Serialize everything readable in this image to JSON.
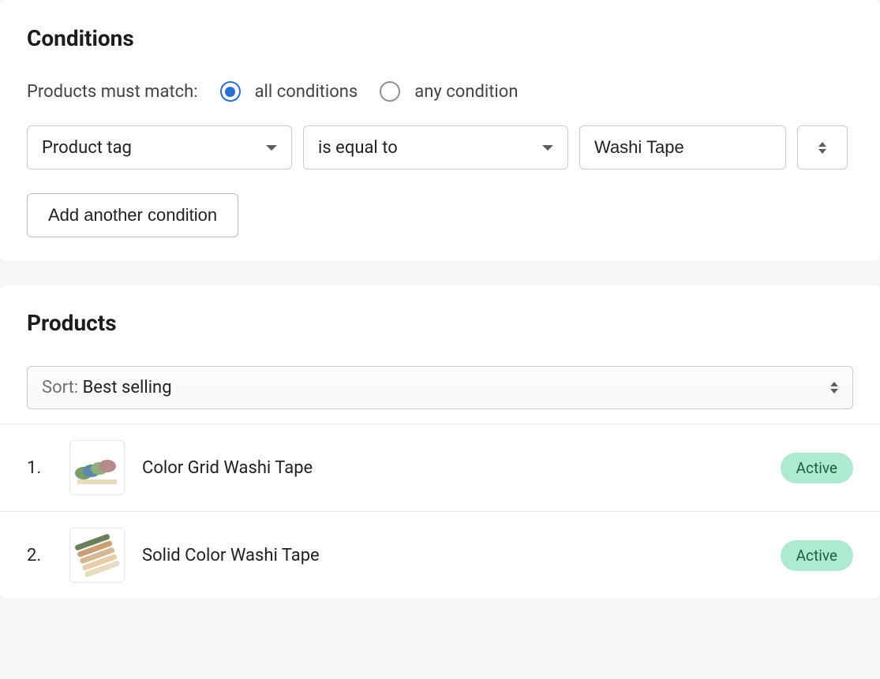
{
  "conditions": {
    "title": "Conditions",
    "match_label": "Products must match:",
    "match_all_label": "all conditions",
    "match_any_label": "any condition",
    "match_selected": "all",
    "rows": [
      {
        "field": "Product tag",
        "operator": "is equal to",
        "value": "Washi Tape"
      }
    ],
    "add_button": "Add another condition"
  },
  "products": {
    "title": "Products",
    "sort_prefix": "Sort: ",
    "sort_value": "Best selling",
    "items": [
      {
        "index": "1.",
        "name": "Color Grid Washi Tape",
        "status": "Active"
      },
      {
        "index": "2.",
        "name": "Solid Color Washi Tape",
        "status": "Active"
      }
    ]
  }
}
